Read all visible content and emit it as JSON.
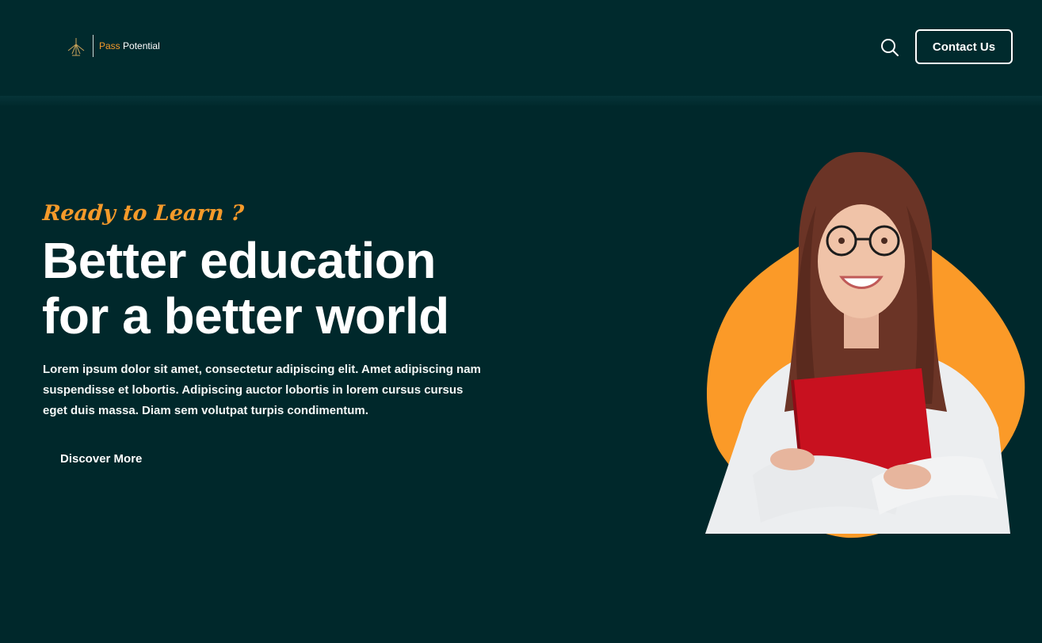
{
  "header": {
    "logo": {
      "brand_first": "Pass",
      "brand_second": "Potential",
      "mark_icon": "wind-turbine-icon"
    },
    "search": {
      "icon": "search-icon"
    },
    "contact_label": "Contact Us"
  },
  "hero": {
    "tagline": "Ready to Learn ?",
    "headline_line1": "Better education",
    "headline_line2": "for a better world",
    "description": "Lorem ipsum dolor sit amet, consectetur adipiscing elit. Amet adipiscing nam suspendisse et lobortis. Adipiscing auctor lobortis in lorem cursus cursus eget duis massa. Diam sem volutpat turpis condimentum.",
    "cta_label": "Discover More",
    "image": "student-with-red-book"
  },
  "colors": {
    "background": "#00282b",
    "accent": "#f59a2a",
    "text": "#ffffff"
  }
}
